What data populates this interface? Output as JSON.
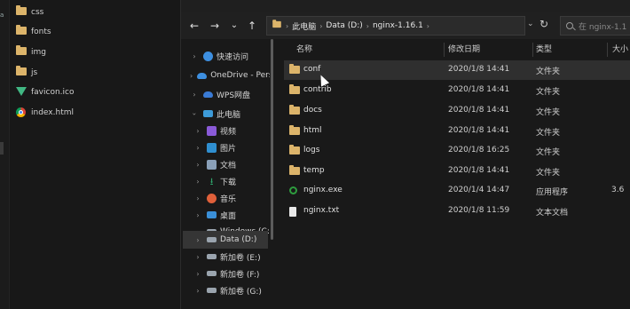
{
  "editor_tree": {
    "items": [
      {
        "label": "css",
        "kind": "folder"
      },
      {
        "label": "fonts",
        "kind": "folder"
      },
      {
        "label": "img",
        "kind": "folder"
      },
      {
        "label": "js",
        "kind": "folder"
      },
      {
        "label": "favicon.ico",
        "kind": "vue"
      },
      {
        "label": "index.html",
        "kind": "chrome"
      }
    ]
  },
  "toolbar": {
    "back": "←",
    "forward": "→",
    "history": "⌄",
    "up": "↑",
    "address": {
      "root_icon": "folder-icon",
      "segments": [
        "此电脑",
        "Data (D:)",
        "nginx-1.16.1"
      ],
      "separator": "›"
    },
    "refresh": "↻",
    "search_placeholder": "在 nginx-1.1"
  },
  "nav": {
    "items": [
      {
        "label": "快速访问",
        "icon": "star-icon",
        "color": "#3d8fe0"
      },
      {
        "label": "OneDrive - Personal",
        "icon": "cloud-icon",
        "color": "#3d8fe0"
      },
      {
        "label": "WPS网盘",
        "icon": "wps-cloud-icon",
        "color": "#3a7bd5"
      },
      {
        "label": "此电脑",
        "icon": "computer-icon",
        "color": "#3d9bd9"
      },
      {
        "label": "视频",
        "icon": "video-icon",
        "color": "#8a5ad8"
      },
      {
        "label": "图片",
        "icon": "picture-icon",
        "color": "#2f8fd0"
      },
      {
        "label": "文档",
        "icon": "document-icon",
        "color": "#8aa0b8"
      },
      {
        "label": "下载",
        "icon": "download-icon",
        "color": "#2fa36b"
      },
      {
        "label": "音乐",
        "icon": "music-icon",
        "color": "#e0603a"
      },
      {
        "label": "桌面",
        "icon": "desktop-icon",
        "color": "#3a8fd8"
      },
      {
        "label": "Windows (C:)",
        "icon": "drive-icon",
        "color": "#9aa4ae"
      },
      {
        "label": "Data (D:)",
        "icon": "drive-icon",
        "color": "#9aa4ae"
      },
      {
        "label": "新加卷 (E:)",
        "icon": "drive-icon",
        "color": "#9aa4ae"
      },
      {
        "label": "新加卷 (F:)",
        "icon": "drive-icon",
        "color": "#9aa4ae"
      },
      {
        "label": "新加卷 (G:)",
        "icon": "drive-icon",
        "color": "#9aa4ae"
      }
    ]
  },
  "files": {
    "columns": {
      "name": "名称",
      "date": "修改日期",
      "type": "类型",
      "size": "大小"
    },
    "rows": [
      {
        "name": "conf",
        "date": "2020/1/8 14:41",
        "type": "文件夹",
        "size": "",
        "icon": "folder"
      },
      {
        "name": "contrib",
        "date": "2020/1/8 14:41",
        "type": "文件夹",
        "size": "",
        "icon": "folder"
      },
      {
        "name": "docs",
        "date": "2020/1/8 14:41",
        "type": "文件夹",
        "size": "",
        "icon": "folder"
      },
      {
        "name": "html",
        "date": "2020/1/8 14:41",
        "type": "文件夹",
        "size": "",
        "icon": "folder"
      },
      {
        "name": "logs",
        "date": "2020/1/8 16:25",
        "type": "文件夹",
        "size": "",
        "icon": "folder"
      },
      {
        "name": "temp",
        "date": "2020/1/8 14:41",
        "type": "文件夹",
        "size": "",
        "icon": "folder"
      },
      {
        "name": "nginx.exe",
        "date": "2020/1/4 14:47",
        "type": "应用程序",
        "size": "3.6",
        "icon": "exe"
      },
      {
        "name": "nginx.txt",
        "date": "2020/1/8 11:59",
        "type": "文本文档",
        "size": "",
        "icon": "txt"
      }
    ]
  },
  "colors": {
    "bg": "#191919",
    "folder": "#dcb46a",
    "hover": "#2f2f2f",
    "selected": "#353535"
  }
}
